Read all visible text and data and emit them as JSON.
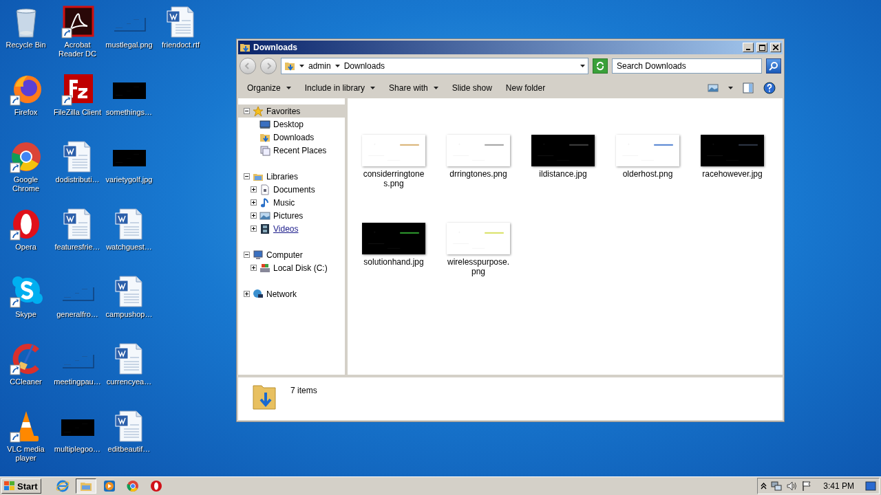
{
  "desktop": {
    "icons": [
      {
        "label": "Recycle Bin",
        "kind": "recycle",
        "shortcut": false
      },
      {
        "label": "Firefox",
        "kind": "firefox",
        "shortcut": true
      },
      {
        "label": "Google Chrome",
        "kind": "chrome",
        "shortcut": true
      },
      {
        "label": "Opera",
        "kind": "opera",
        "shortcut": true
      },
      {
        "label": "Skype",
        "kind": "skype",
        "shortcut": true
      },
      {
        "label": "CCleaner",
        "kind": "ccleaner",
        "shortcut": true
      },
      {
        "label": "VLC media player",
        "kind": "vlc",
        "shortcut": true
      },
      {
        "label": "Acrobat Reader DC",
        "kind": "acrobat",
        "shortcut": true
      },
      {
        "label": "FileZilla Client",
        "kind": "filezilla",
        "shortcut": true
      },
      {
        "label": "dodistributi…",
        "kind": "word",
        "shortcut": false
      },
      {
        "label": "featuresfrie…",
        "kind": "word",
        "shortcut": false
      },
      {
        "label": "generalfro…",
        "kind": "image-blank",
        "shortcut": false
      },
      {
        "label": "meetingpau…",
        "kind": "image-blank",
        "shortcut": false
      },
      {
        "label": "multiplegoo…",
        "kind": "image-dark",
        "shortcut": false
      },
      {
        "label": "mustlegal.png",
        "kind": "image-blank",
        "shortcut": false
      },
      {
        "label": "somethings…",
        "kind": "image-dark",
        "shortcut": false
      },
      {
        "label": "varietygolf.jpg",
        "kind": "image-dark",
        "shortcut": false
      },
      {
        "label": "watchguest…",
        "kind": "word",
        "shortcut": false
      },
      {
        "label": "campushop…",
        "kind": "word",
        "shortcut": false
      },
      {
        "label": "currencyea…",
        "kind": "word",
        "shortcut": false
      },
      {
        "label": "editbeautif…",
        "kind": "word",
        "shortcut": false
      },
      {
        "label": "friendoct.rtf",
        "kind": "word",
        "shortcut": false
      }
    ]
  },
  "window": {
    "title": "Downloads",
    "breadcrumb": [
      "admin",
      "Downloads"
    ],
    "search": {
      "placeholder": "Search Downloads"
    },
    "toolbar": [
      {
        "label": "Organize",
        "kind": "menu"
      },
      {
        "label": "Include in library",
        "kind": "menu"
      },
      {
        "label": "Share with",
        "kind": "menu"
      },
      {
        "label": "Slide show",
        "kind": "plain"
      },
      {
        "label": "New folder",
        "kind": "plain"
      }
    ],
    "nav": [
      {
        "label": "Favorites",
        "kind": "star",
        "expanded": true,
        "selected": true,
        "hovered": false,
        "children": [
          {
            "label": "Desktop",
            "kind": "desktop",
            "selected": false,
            "hovered": false
          },
          {
            "label": "Downloads",
            "kind": "downloads",
            "selected": false,
            "hovered": false
          },
          {
            "label": "Recent Places",
            "kind": "recent",
            "selected": false,
            "hovered": false
          }
        ]
      },
      {
        "label": "Libraries",
        "kind": "library",
        "expanded": true,
        "selected": false,
        "hovered": false,
        "children": [
          {
            "label": "Documents",
            "kind": "documents",
            "expanded": false,
            "selected": false,
            "hovered": false
          },
          {
            "label": "Music",
            "kind": "music",
            "expanded": false,
            "selected": false,
            "hovered": false
          },
          {
            "label": "Pictures",
            "kind": "pictures",
            "expanded": false,
            "selected": false,
            "hovered": false
          },
          {
            "label": "Videos",
            "kind": "videos",
            "expanded": false,
            "selected": false,
            "hovered": true
          }
        ]
      },
      {
        "label": "Computer",
        "kind": "computer",
        "expanded": true,
        "selected": false,
        "hovered": false,
        "children": [
          {
            "label": "Local Disk (C:)",
            "kind": "disk",
            "expanded": false,
            "selected": false,
            "hovered": false
          }
        ]
      },
      {
        "label": "Network",
        "kind": "network",
        "expanded": false,
        "selected": false,
        "hovered": false
      }
    ],
    "files": [
      {
        "name": "considerringtones.png",
        "kind": "picture"
      },
      {
        "name": "drringtones.png",
        "kind": "picture"
      },
      {
        "name": "ildistance.jpg",
        "kind": "picture"
      },
      {
        "name": "olderhost.png",
        "kind": "picture"
      },
      {
        "name": "racehowever.jpg",
        "kind": "picture"
      },
      {
        "name": "solutionhand.jpg",
        "kind": "picture"
      },
      {
        "name": "wirelesspurpose.png",
        "kind": "picture"
      }
    ],
    "status": "7 items"
  },
  "taskbar": {
    "start": "Start",
    "items": [
      {
        "kind": "ie",
        "active": false
      },
      {
        "kind": "explorer",
        "active": true
      },
      {
        "kind": "media",
        "active": false
      },
      {
        "kind": "chrome",
        "active": false
      },
      {
        "kind": "opera",
        "active": false
      }
    ],
    "clock": "3:41 PM"
  }
}
